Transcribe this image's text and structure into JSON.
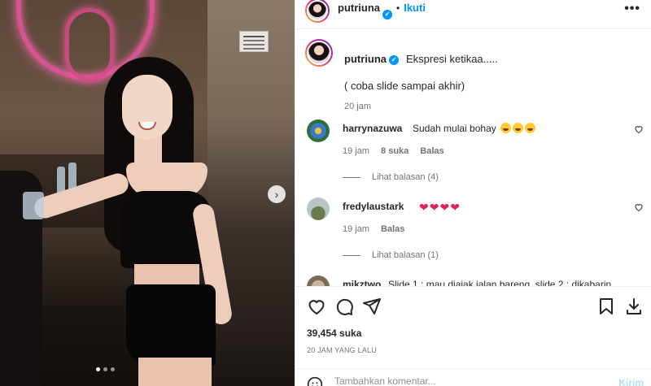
{
  "post": {
    "author": "putriuna",
    "follow_label": "Ikuti",
    "more_label": "•••",
    "caption_line1": "Ekspresi ketikaa.....",
    "caption_line2": "( coba slide sampai akhir)",
    "caption_time": "20 jam"
  },
  "comments": [
    {
      "user": "harrynazuwa",
      "text": "Sudah mulai bohay",
      "emojis": 3,
      "time": "19 jam",
      "likes": "8 suka",
      "reply_label": "Balas",
      "view_replies": "Lihat balasan (4)"
    },
    {
      "user": "fredylaustark",
      "text": "",
      "hearts": 4,
      "time": "19 jam",
      "reply_label": "Balas",
      "view_replies": "Lihat balasan (1)"
    },
    {
      "user": "mikztwo",
      "text": "Slide 1 : mau diajak jalan bareng, slide 2 : dikabarin..."
    }
  ],
  "actions": {
    "likes": "39,454 suka",
    "time_ago": "20 JAM YANG LALU",
    "comment_placeholder": "Tambahkan komentar...",
    "send_label": "Kirim"
  },
  "carousel": {
    "total_slides": 3,
    "current_slide": 1
  },
  "colors": {
    "accent": "#0095f6",
    "muted": "#737373",
    "send_disabled": "#b2dffc"
  },
  "icons": [
    "verified-icon",
    "more-options-icon",
    "heart-icon",
    "comment-icon",
    "share-icon",
    "bookmark-icon",
    "download-icon",
    "emoji-icon",
    "next-arrow-icon"
  ]
}
